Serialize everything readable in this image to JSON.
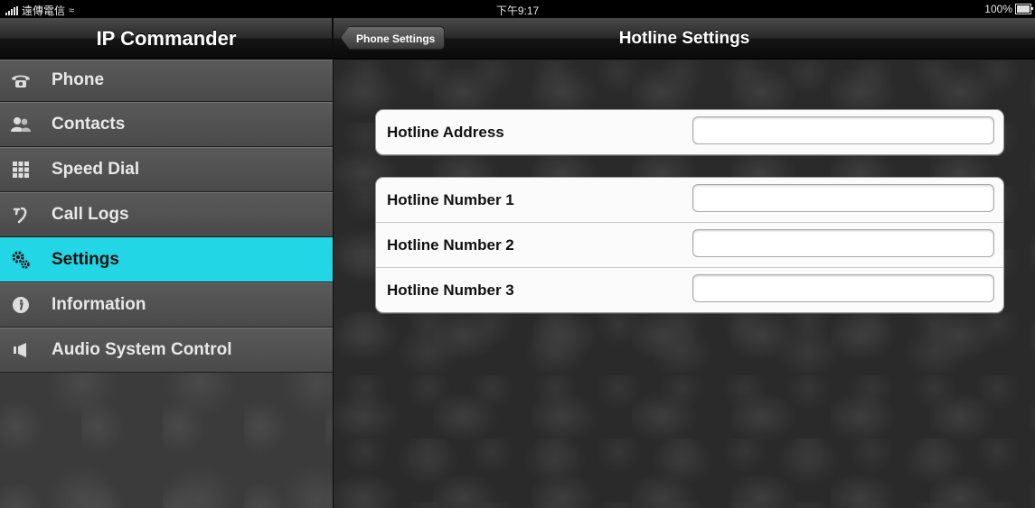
{
  "status_bar": {
    "carrier": "遠傳電信",
    "time": "下午9:17",
    "battery": "100%",
    "battery_level": 1.0
  },
  "sidebar": {
    "title": "IP Commander",
    "items": [
      {
        "label": "Phone",
        "icon": "phone-icon"
      },
      {
        "label": "Contacts",
        "icon": "contacts-icon"
      },
      {
        "label": "Speed Dial",
        "icon": "keypad-icon"
      },
      {
        "label": "Call Logs",
        "icon": "call-logs-icon"
      },
      {
        "label": "Settings",
        "icon": "gears-icon",
        "active": true
      },
      {
        "label": "Information",
        "icon": "info-icon"
      },
      {
        "label": "Audio System Control",
        "icon": "speaker-icon"
      }
    ],
    "active_color": "#23d6e5"
  },
  "detail": {
    "back_label": "Phone Settings",
    "title": "Hotline Settings",
    "group1": [
      {
        "label": "Hotline Address",
        "value": "",
        "placeholder": ""
      }
    ],
    "group2": [
      {
        "label": "Hotline Number 1",
        "value": "",
        "placeholder": ""
      },
      {
        "label": "Hotline Number 2",
        "value": "",
        "placeholder": ""
      },
      {
        "label": "Hotline Number 3",
        "value": "",
        "placeholder": ""
      }
    ]
  }
}
